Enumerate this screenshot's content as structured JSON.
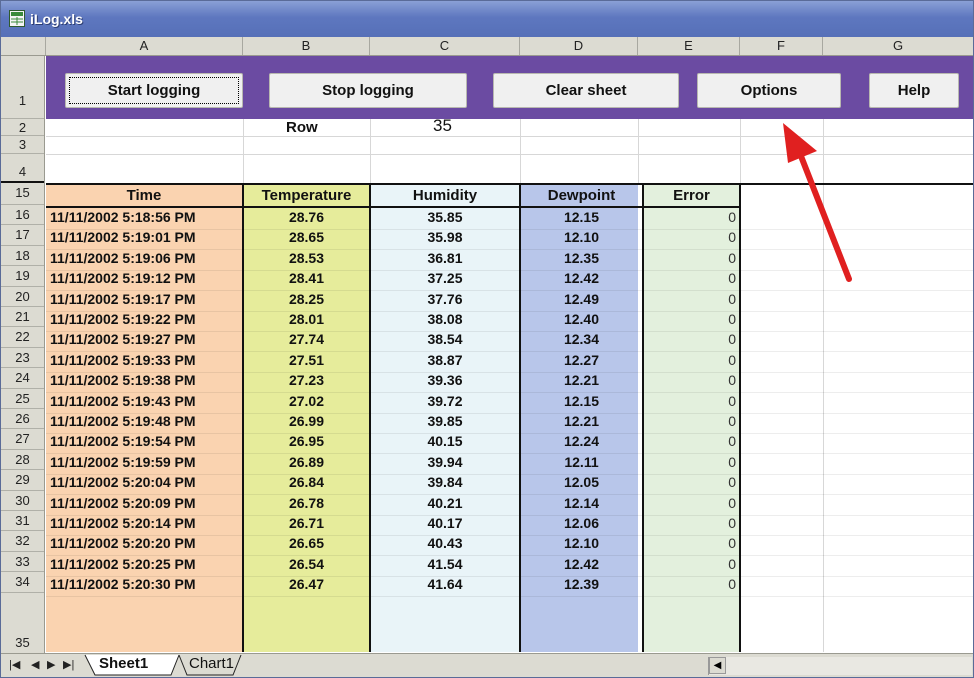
{
  "window": {
    "title": "iLog.xls"
  },
  "columns": [
    "A",
    "B",
    "C",
    "D",
    "E",
    "F",
    "G"
  ],
  "buttons": {
    "start": "Start logging",
    "stop": "Stop logging",
    "clear": "Clear sheet",
    "options": "Options",
    "help": "Help"
  },
  "row_info": {
    "label": "Row",
    "value": "35"
  },
  "row_numbers_top": [
    "1",
    "2",
    "3",
    "4"
  ],
  "table": {
    "headers": [
      "Time",
      "Temperature",
      "Humidity",
      "Dewpoint",
      "Error"
    ],
    "header_row_number": "15",
    "rows": [
      {
        "row": "16",
        "time": "11/11/2002  5:18:56 PM",
        "temp": "28.76",
        "hum": "35.85",
        "dew": "12.15",
        "err": "0"
      },
      {
        "row": "17",
        "time": "11/11/2002  5:19:01 PM",
        "temp": "28.65",
        "hum": "35.98",
        "dew": "12.10",
        "err": "0"
      },
      {
        "row": "18",
        "time": "11/11/2002  5:19:06 PM",
        "temp": "28.53",
        "hum": "36.81",
        "dew": "12.35",
        "err": "0"
      },
      {
        "row": "19",
        "time": "11/11/2002  5:19:12 PM",
        "temp": "28.41",
        "hum": "37.25",
        "dew": "12.42",
        "err": "0"
      },
      {
        "row": "20",
        "time": "11/11/2002  5:19:17 PM",
        "temp": "28.25",
        "hum": "37.76",
        "dew": "12.49",
        "err": "0"
      },
      {
        "row": "21",
        "time": "11/11/2002  5:19:22 PM",
        "temp": "28.01",
        "hum": "38.08",
        "dew": "12.40",
        "err": "0"
      },
      {
        "row": "22",
        "time": "11/11/2002  5:19:27 PM",
        "temp": "27.74",
        "hum": "38.54",
        "dew": "12.34",
        "err": "0"
      },
      {
        "row": "23",
        "time": "11/11/2002  5:19:33 PM",
        "temp": "27.51",
        "hum": "38.87",
        "dew": "12.27",
        "err": "0"
      },
      {
        "row": "24",
        "time": "11/11/2002  5:19:38 PM",
        "temp": "27.23",
        "hum": "39.36",
        "dew": "12.21",
        "err": "0"
      },
      {
        "row": "25",
        "time": "11/11/2002  5:19:43 PM",
        "temp": "27.02",
        "hum": "39.72",
        "dew": "12.15",
        "err": "0"
      },
      {
        "row": "26",
        "time": "11/11/2002  5:19:48 PM",
        "temp": "26.99",
        "hum": "39.85",
        "dew": "12.21",
        "err": "0"
      },
      {
        "row": "27",
        "time": "11/11/2002  5:19:54 PM",
        "temp": "26.95",
        "hum": "40.15",
        "dew": "12.24",
        "err": "0"
      },
      {
        "row": "28",
        "time": "11/11/2002  5:19:59 PM",
        "temp": "26.89",
        "hum": "39.94",
        "dew": "12.11",
        "err": "0"
      },
      {
        "row": "29",
        "time": "11/11/2002  5:20:04 PM",
        "temp": "26.84",
        "hum": "39.84",
        "dew": "12.05",
        "err": "0"
      },
      {
        "row": "30",
        "time": "11/11/2002  5:20:09 PM",
        "temp": "26.78",
        "hum": "40.21",
        "dew": "12.14",
        "err": "0"
      },
      {
        "row": "31",
        "time": "11/11/2002  5:20:14 PM",
        "temp": "26.71",
        "hum": "40.17",
        "dew": "12.06",
        "err": "0"
      },
      {
        "row": "32",
        "time": "11/11/2002  5:20:20 PM",
        "temp": "26.65",
        "hum": "40.43",
        "dew": "12.10",
        "err": "0"
      },
      {
        "row": "33",
        "time": "11/11/2002  5:20:25 PM",
        "temp": "26.54",
        "hum": "41.54",
        "dew": "12.42",
        "err": "0"
      },
      {
        "row": "34",
        "time": "11/11/2002  5:20:30 PM",
        "temp": "26.47",
        "hum": "41.64",
        "dew": "12.39",
        "err": "0"
      }
    ],
    "last_row_number": "35"
  },
  "sheet_tabs": [
    "Sheet1",
    "Chart1"
  ],
  "colors": {
    "toolbar_band": "#6b4ba2",
    "time_col": "#fad3b0",
    "temp_col": "#e6ec9b",
    "hum_col": "#e9f4f8",
    "dew_col": "#b8c6ea",
    "err_col": "#e3f0dd",
    "annotation_arrow": "#e02020"
  }
}
